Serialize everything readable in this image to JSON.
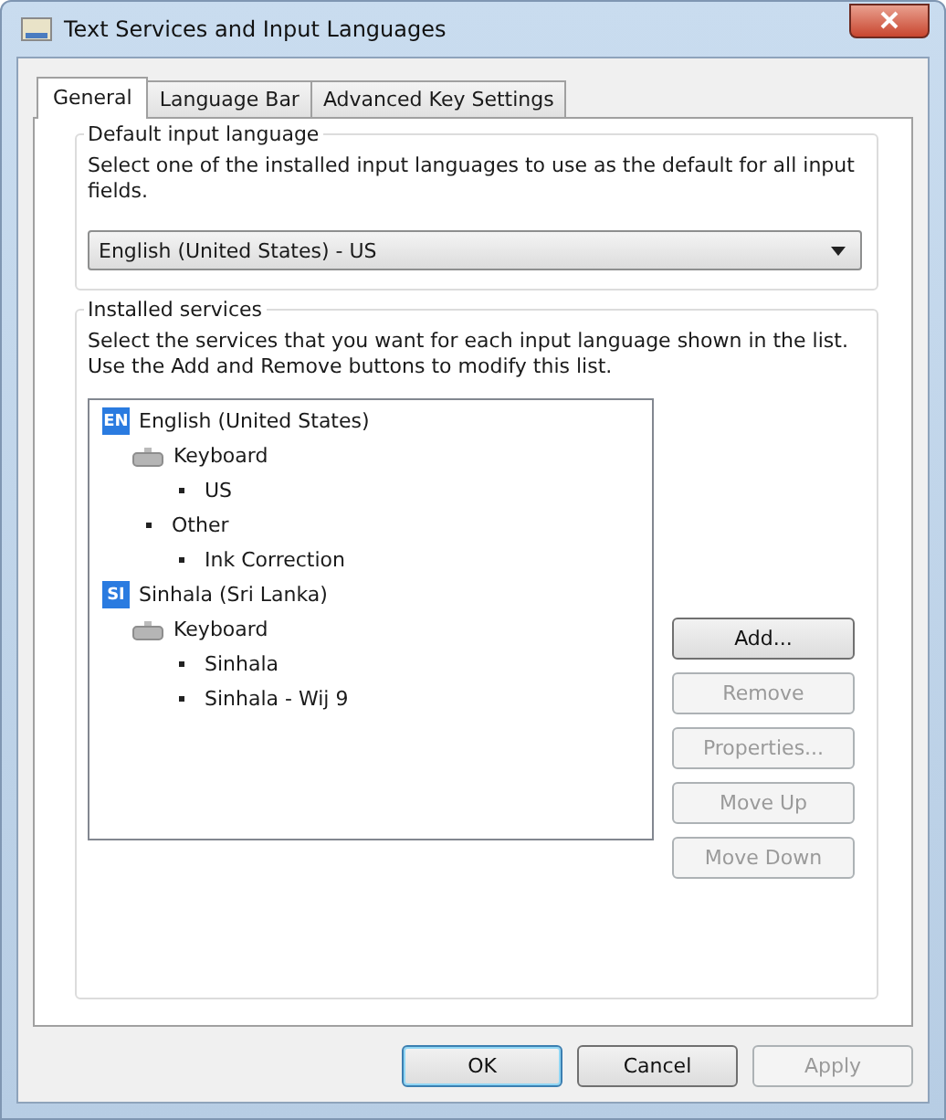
{
  "window": {
    "title": "Text Services and Input Languages"
  },
  "tabs": [
    {
      "label": "General",
      "selected": true
    },
    {
      "label": "Language Bar",
      "selected": false
    },
    {
      "label": "Advanced Key Settings",
      "selected": false
    }
  ],
  "default_input_language": {
    "heading": "Default input language",
    "description": "Select one of the installed input languages to use as the default for all input fields.",
    "value": "English (United States) - US"
  },
  "installed_services": {
    "heading": "Installed services",
    "description": "Select the services that you want for each input language shown in the list. Use the Add and Remove buttons to modify this list.",
    "tree": [
      {
        "kind": "language",
        "badge": "EN",
        "label": "English (United States)",
        "children": [
          {
            "kind": "category",
            "label": "Keyboard",
            "children": [
              {
                "kind": "service",
                "label": "US"
              }
            ]
          },
          {
            "kind": "service",
            "label": "Other",
            "children": [
              {
                "kind": "service",
                "label": "Ink Correction"
              }
            ]
          }
        ]
      },
      {
        "kind": "language",
        "badge": "SI",
        "label": "Sinhala (Sri Lanka)",
        "children": [
          {
            "kind": "category",
            "label": "Keyboard",
            "children": [
              {
                "kind": "service",
                "label": "Sinhala"
              },
              {
                "kind": "service",
                "label": "Sinhala - Wij 9"
              }
            ]
          }
        ]
      }
    ],
    "buttons": [
      {
        "label": "Add...",
        "disabled": false
      },
      {
        "label": "Remove",
        "disabled": true
      },
      {
        "label": "Properties...",
        "disabled": true
      },
      {
        "label": "Move Up",
        "disabled": true
      },
      {
        "label": "Move Down",
        "disabled": true
      }
    ]
  },
  "footer_buttons": [
    {
      "label": "OK",
      "disabled": false,
      "default": true
    },
    {
      "label": "Cancel",
      "disabled": false,
      "default": false
    },
    {
      "label": "Apply",
      "disabled": true,
      "default": false
    }
  ]
}
